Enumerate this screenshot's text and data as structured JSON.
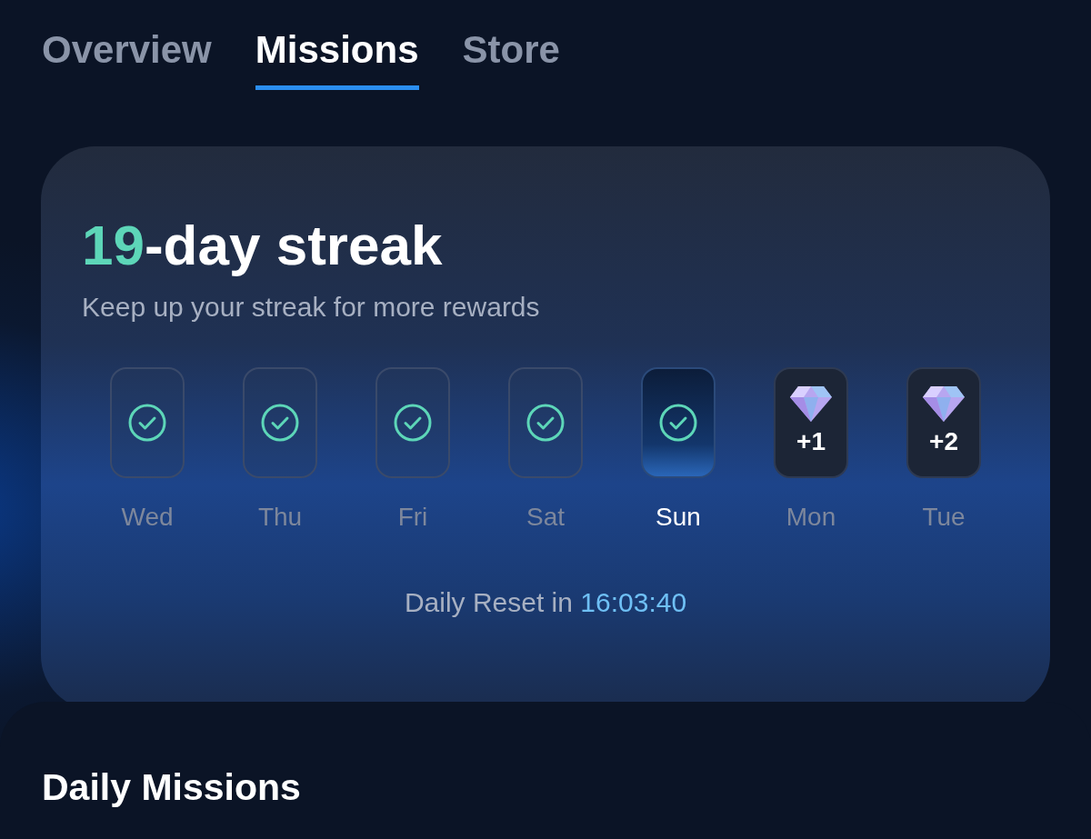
{
  "tabs": [
    {
      "label": "Overview",
      "selected": false
    },
    {
      "label": "Missions",
      "selected": true
    },
    {
      "label": "Store",
      "selected": false
    }
  ],
  "streak": {
    "count": "19",
    "label": "-day streak",
    "subtitle": "Keep up your streak for more rewards",
    "days": [
      {
        "label": "Wed",
        "kind": "done",
        "selected": false
      },
      {
        "label": "Thu",
        "kind": "done",
        "selected": false
      },
      {
        "label": "Fri",
        "kind": "done",
        "selected": false
      },
      {
        "label": "Sat",
        "kind": "done",
        "selected": false
      },
      {
        "label": "Sun",
        "kind": "done",
        "selected": true
      },
      {
        "label": "Mon",
        "kind": "reward",
        "reward": "+1",
        "selected": false
      },
      {
        "label": "Tue",
        "kind": "reward",
        "reward": "+2",
        "selected": false
      }
    ],
    "reset_label": "Daily Reset in",
    "reset_time": "16:03:40"
  },
  "missions": {
    "title": "Daily Missions"
  }
}
